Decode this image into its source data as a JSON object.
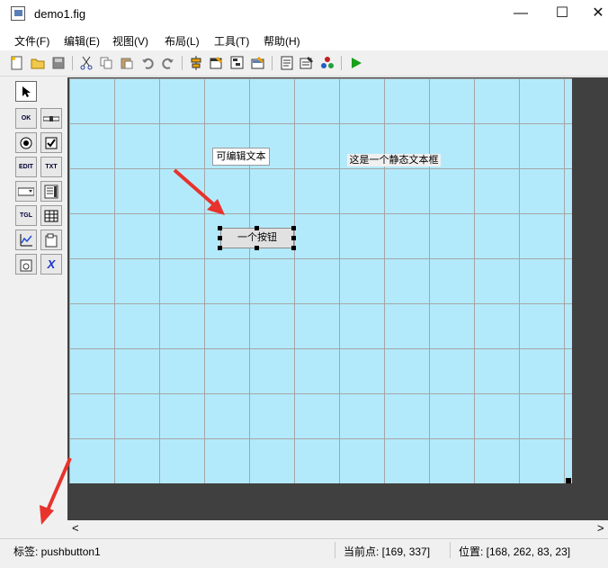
{
  "window": {
    "title": "demo1.fig",
    "minimize_glyph": "—",
    "maximize_glyph": "☐",
    "close_glyph": "✕"
  },
  "menu": [
    "文件(F)",
    "编辑(E)",
    "视图(V)",
    "布局(L)",
    "工具(T)",
    "帮助(H)"
  ],
  "toolbar": {
    "icons": [
      "new-file-icon",
      "open-folder-icon",
      "save-icon",
      "cut-icon",
      "copy-icon",
      "paste-icon",
      "undo-icon",
      "redo-icon",
      "align-icon",
      "menu-editor-icon",
      "tab-order-icon",
      "toolbar-editor-icon",
      "editor-icon",
      "property-inspector-icon",
      "object-browser-icon",
      "run-icon"
    ]
  },
  "palette": {
    "tools": [
      {
        "name": "select-tool",
        "glyph": "➤"
      },
      {
        "name": "pushbutton-tool",
        "glyph": "OK"
      },
      {
        "name": "slider-tool",
        "glyph": "▭"
      },
      {
        "name": "radiobutton-tool",
        "glyph": "◉"
      },
      {
        "name": "checkbox-tool",
        "glyph": "☑"
      },
      {
        "name": "edit-text-tool",
        "glyph": "EDIT"
      },
      {
        "name": "static-text-tool",
        "glyph": "TXT"
      },
      {
        "name": "popup-menu-tool",
        "glyph": "▭▾"
      },
      {
        "name": "listbox-tool",
        "glyph": "≣"
      },
      {
        "name": "toggle-button-tool",
        "glyph": "TGL"
      },
      {
        "name": "table-tool",
        "glyph": "▦"
      },
      {
        "name": "axes-tool",
        "glyph": "📈"
      },
      {
        "name": "panel-tool",
        "glyph": "▢"
      },
      {
        "name": "button-group-tool",
        "glyph": "◍"
      },
      {
        "name": "activex-tool",
        "glyph": "X"
      }
    ]
  },
  "canvas": {
    "edit_text": "可编辑文本",
    "static_text": "这是一个静态文本框",
    "pushbutton": "一个按钮"
  },
  "scroll": {
    "left_glyph": "<",
    "right_glyph": ">"
  },
  "status": {
    "tag": "标签: pushbutton1",
    "current_point": "当前点:  [169, 337]",
    "position": "位置: [168, 262, 83, 23]"
  }
}
